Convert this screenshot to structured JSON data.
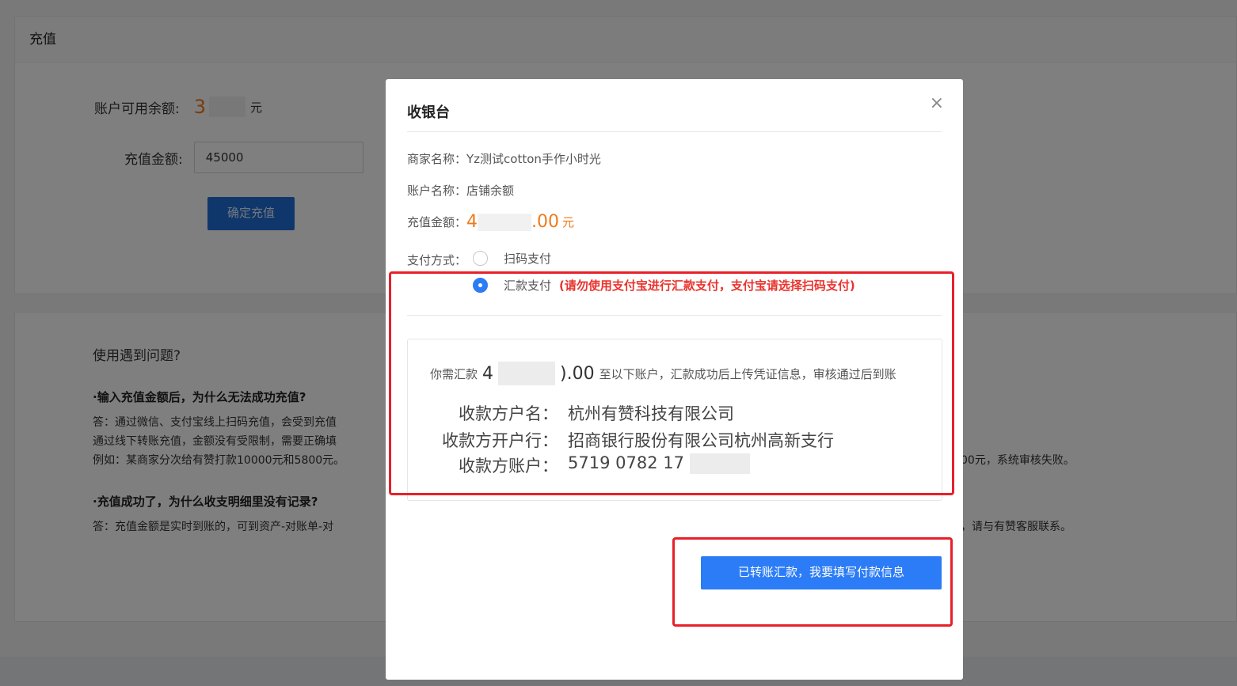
{
  "page": {
    "card_title": "充值",
    "balance_label": "账户可用余额:",
    "balance_value": "3",
    "balance_unit": "元",
    "amount_label": "充值金额:",
    "amount_value": "45000",
    "confirm_label": "确定充值"
  },
  "faq": {
    "title": "使用遇到问题?",
    "q1": "·输入充值金额后，为什么无法成功充值?",
    "a1_line1": "答：通过微信、支付宝线上扫码充值，会受到充值",
    "a1_line2": "通过线下转账充值，金额没有受限制，需要正确填",
    "a1_line3": "例如：某商家分次给有赞打款10000元和5800元。",
    "a1_line3_tail": "00元，系统审核失败。",
    "q2": "·充值成功了，为什么收支明细里没有记录?",
    "a2_line1": "答：充值金额是实时到账的，可到资产-对账单-对",
    "a2_line1_tail": "，请与有赞客服联系。"
  },
  "modal": {
    "title": "收银台",
    "close": "×",
    "merchant": "商家名称：Yz测试cotton手作小时光",
    "account": "账户名称：店铺余额",
    "amount_label": "充值金额：",
    "amount_prefix": "4",
    "amount_suffix": ".00",
    "amount_unit": "元",
    "pay_method_label": "支付方式：",
    "option_scan": "扫码支付",
    "option_transfer": "汇款支付",
    "transfer_warning": "(请勿使用支付宝进行汇款支付，支付宝请选择扫码支付)",
    "need_prefix": "你需汇款",
    "need_amount_prefix": "4",
    "need_amount_suffix": ").00",
    "need_suffix": "至以下账户，汇款成功后上传凭证信息，审核通过后到账",
    "payee_name_label": "收款方户名：",
    "payee_name": "杭州有赞科技有限公司",
    "payee_bank_label": "收款方开户行：",
    "payee_bank": "招商银行股份有限公司杭州高新支行",
    "payee_account_label": "收款方账户：",
    "payee_account": "5719 0782 17",
    "submit_label": "已转账汇款，我要填写付款信息"
  },
  "colors": {
    "primary": "#2b7cf6",
    "orange": "#f07a1a",
    "warning_red": "#e9322c",
    "annotation_red": "#e8202a"
  }
}
